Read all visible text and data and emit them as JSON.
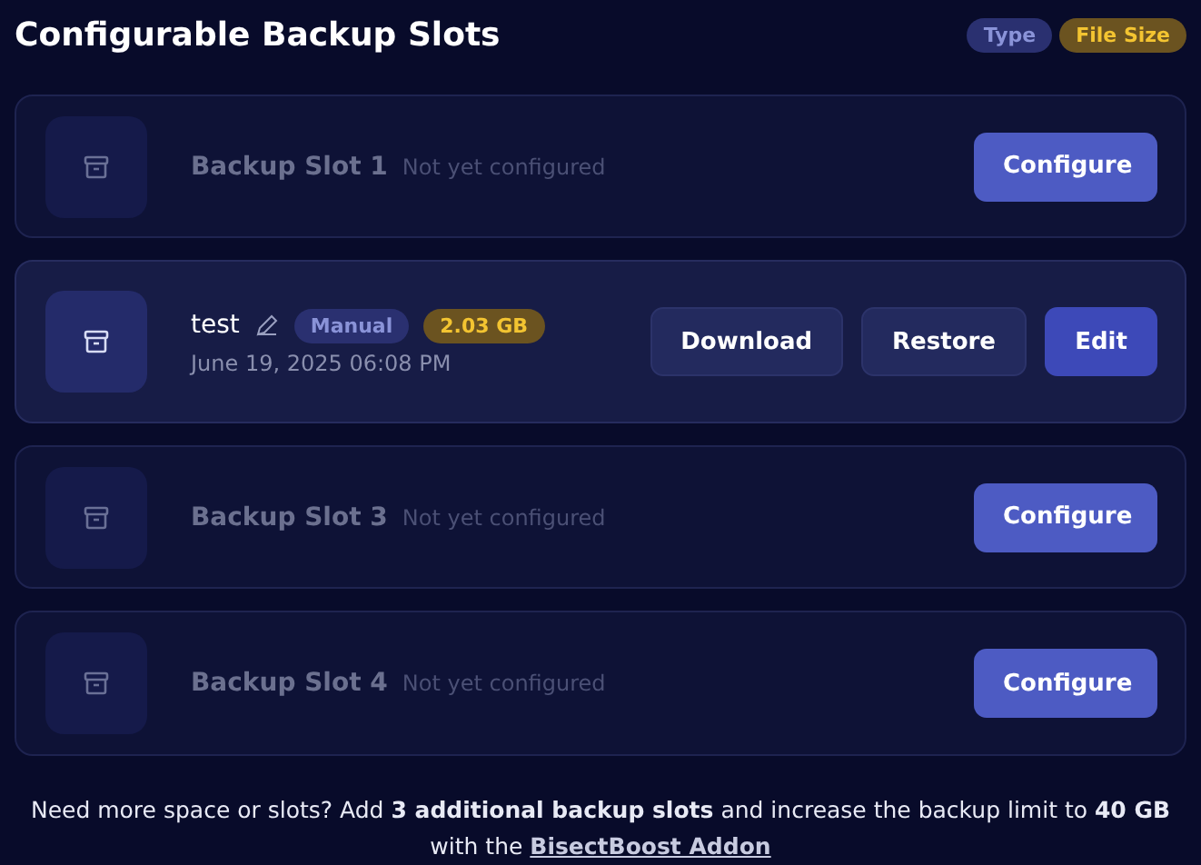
{
  "title": "Configurable Backup Slots",
  "legend": [
    {
      "label": "Type",
      "kind": "type"
    },
    {
      "label": "File Size",
      "kind": "size"
    }
  ],
  "slots": [
    {
      "kind": "empty",
      "name": "Backup Slot 1",
      "status": "Not yet configured",
      "buttons": [
        "Configure"
      ]
    },
    {
      "kind": "configured",
      "name": "test",
      "type": "Manual",
      "size": "2.03 GB",
      "date": "June 19, 2025 06:08 PM",
      "buttons": [
        "Download",
        "Restore",
        "Edit"
      ]
    },
    {
      "kind": "empty",
      "name": "Backup Slot 3",
      "status": "Not yet configured",
      "buttons": [
        "Configure"
      ]
    },
    {
      "kind": "empty",
      "name": "Backup Slot 4",
      "status": "Not yet configured",
      "buttons": [
        "Configure"
      ]
    }
  ],
  "footer": {
    "text": "Need more space or slots? Add **3 additional backup slots** and increase the backup limit to **40 GB** with the",
    "link": "BisectBoost Addon"
  }
}
